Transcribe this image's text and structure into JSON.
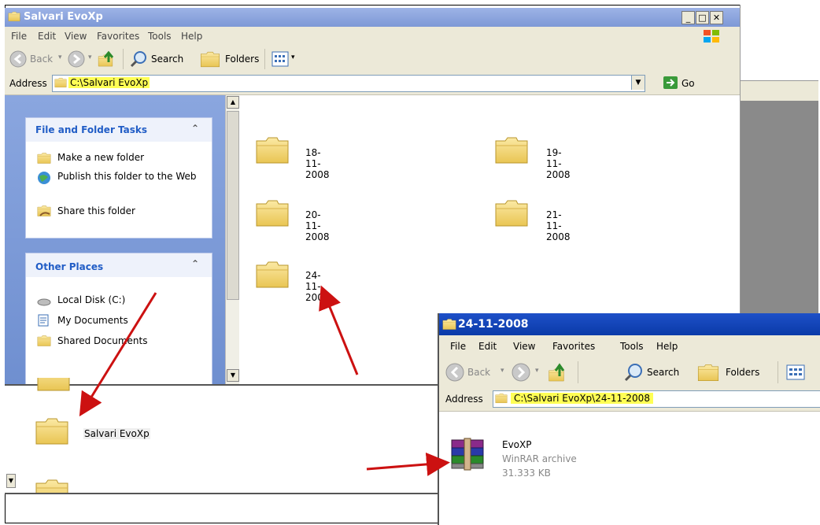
{
  "window_main": {
    "title": "Salvari EvoXp",
    "menu": [
      "File",
      "Edit",
      "View",
      "Favorites",
      "Tools",
      "Help"
    ],
    "toolbar": {
      "back": "Back",
      "search": "Search",
      "folders": "Folders"
    },
    "address_label": "Address",
    "address_value": "C:\\Salvari EvoXp",
    "go_label": "Go",
    "tasks_panel": {
      "title": "File and Folder Tasks",
      "items": [
        "Make a new folder",
        "Publish this folder to the Web",
        "Share this folder"
      ]
    },
    "places_panel": {
      "title": "Other Places",
      "items": [
        "Local Disk (C:)",
        "My Documents",
        "Shared Documents"
      ]
    },
    "folders": [
      "18-11-2008",
      "19-11-2008",
      "20-11-2008",
      "21-11-2008",
      "24-11-2008"
    ]
  },
  "window_desktop": {
    "folder_label": "Salvari EvoXp"
  },
  "window_sub": {
    "title": "24-11-2008",
    "menu": [
      "File",
      "Edit",
      "View",
      "Favorites",
      "Tools",
      "Help"
    ],
    "toolbar": {
      "back": "Back",
      "search": "Search",
      "folders": "Folders"
    },
    "address_label": "Address",
    "address_value": "C:\\Salvari EvoXp\\24-11-2008",
    "file": {
      "name": "EvoXP",
      "type": "WinRAR archive",
      "size": "31.333 KB"
    }
  },
  "colors": {
    "arrow": "#cc1111",
    "highlight": "#ffff55",
    "folder": "#f4d56a"
  }
}
